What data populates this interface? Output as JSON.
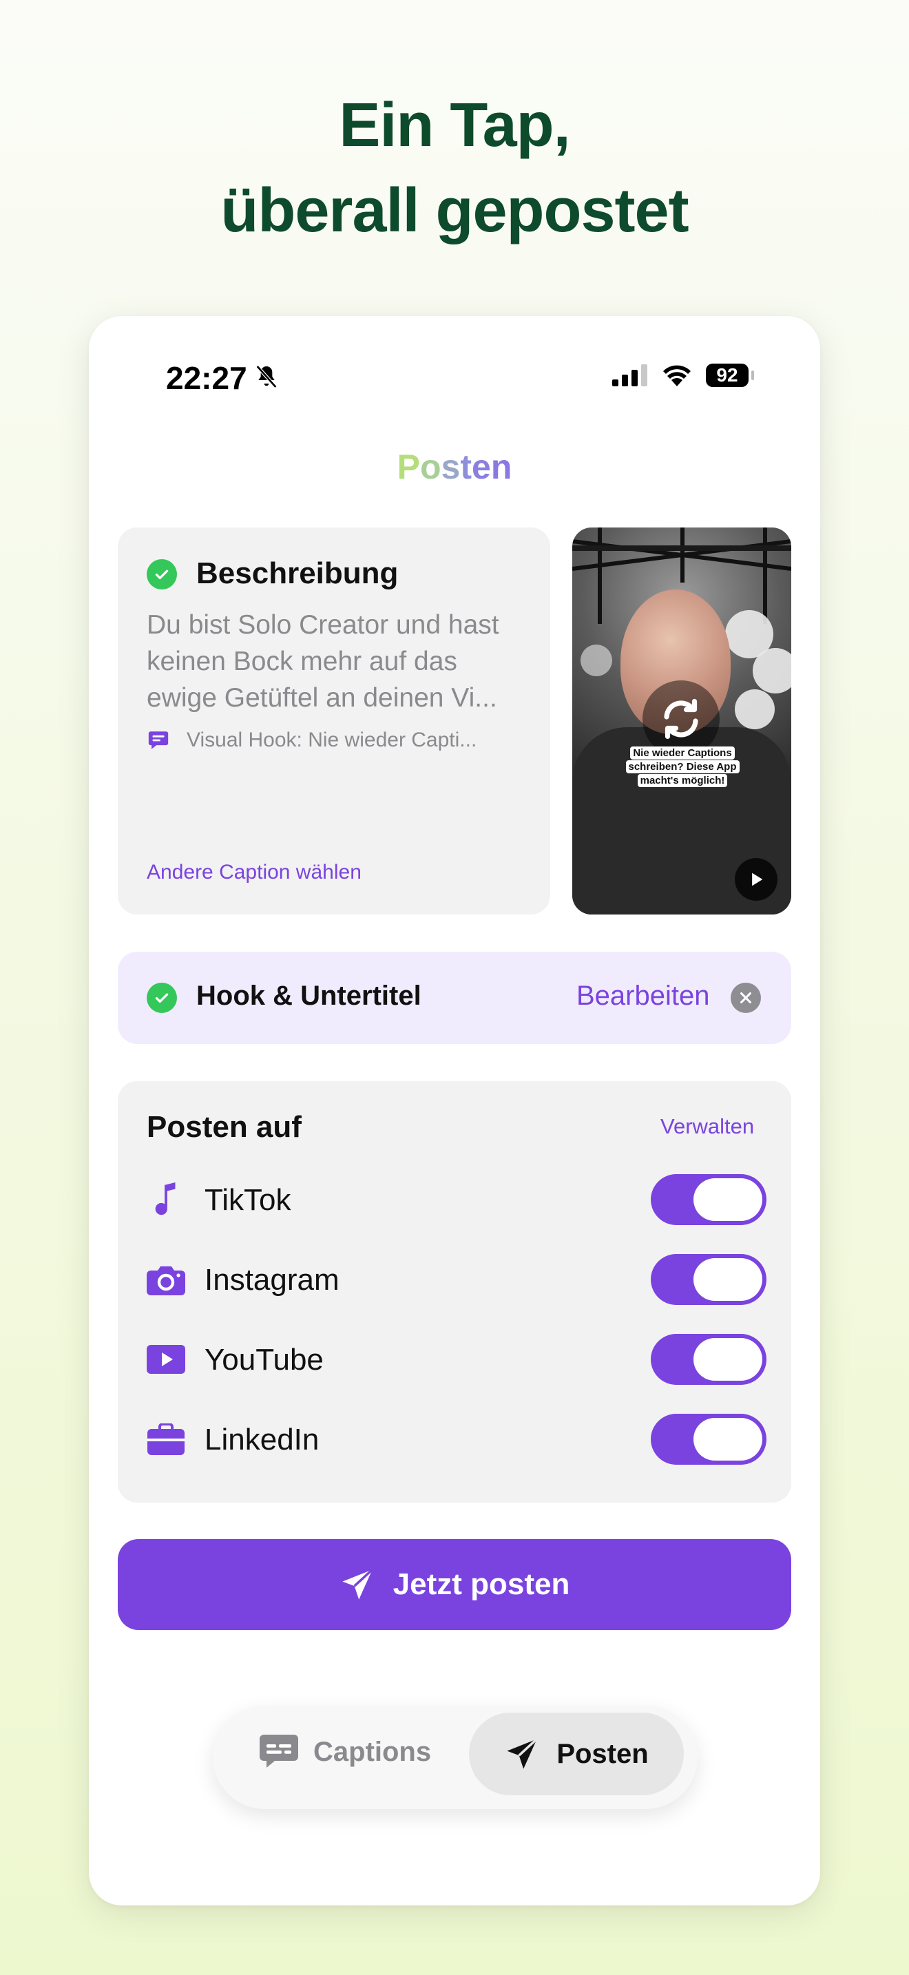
{
  "headline": {
    "line1": "Ein Tap,",
    "line2": "überall gepostet"
  },
  "status_bar": {
    "time": "22:27",
    "battery": "92",
    "icons": [
      "bell-slash-icon",
      "signal-icon",
      "wifi-icon",
      "battery-icon"
    ]
  },
  "screen": {
    "title": "Posten"
  },
  "description_card": {
    "title": "Beschreibung",
    "text_lines": [
      "Du bist Solo Creator und hast",
      "keinen Bock mehr auf das",
      "ewige Getüftel an deinen Vi..."
    ],
    "hook_text": "Visual Hook: Nie wieder Capti...",
    "other_caption_link": "Andere Caption wählen"
  },
  "video_thumbnail": {
    "overlay_text": [
      "Nie wieder Captions",
      "schreiben? Diese App",
      "macht's möglich!"
    ]
  },
  "hook_card": {
    "title": "Hook & Untertitel",
    "edit_label": "Bearbeiten"
  },
  "post_on": {
    "title": "Posten auf",
    "manage_label": "Verwalten",
    "platforms": [
      {
        "label": "TikTok",
        "icon": "music-note-icon",
        "enabled": true
      },
      {
        "label": "Instagram",
        "icon": "camera-icon",
        "enabled": true
      },
      {
        "label": "YouTube",
        "icon": "play-rectangle-icon",
        "enabled": true
      },
      {
        "label": "LinkedIn",
        "icon": "briefcase-icon",
        "enabled": true
      }
    ]
  },
  "post_button": {
    "label": "Jetzt posten"
  },
  "tab_bar": {
    "captions_label": "Captions",
    "posten_label": "Posten",
    "active": "Posten"
  },
  "colors": {
    "accent": "#7a43e0",
    "headline": "#0e4a2c",
    "check": "#34c759",
    "card": "#f2f2f2",
    "hook_card": "#f1ecfd"
  }
}
